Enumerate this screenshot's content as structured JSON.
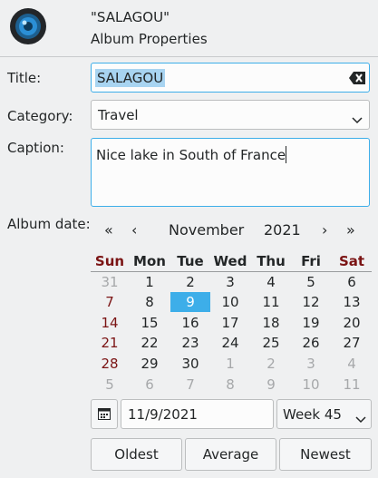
{
  "header": {
    "title": "\"SALAGOU\"",
    "subtitle": "Album Properties"
  },
  "form": {
    "title_label": "Title:",
    "title_value": "SALAGOU",
    "category_label": "Category:",
    "category_value": "Travel",
    "caption_label": "Caption:",
    "caption_value": "Nice lake in South of France",
    "date_label": "Album date:"
  },
  "calendar": {
    "nav_first": "«",
    "nav_prev": "‹",
    "month": "November",
    "year": "2021",
    "nav_next": "›",
    "nav_last": "»",
    "weekdays": [
      "Sun",
      "Mon",
      "Tue",
      "Wed",
      "Thu",
      "Fri",
      "Sat"
    ],
    "weeks": [
      [
        "31",
        "1",
        "2",
        "3",
        "4",
        "5",
        "6"
      ],
      [
        "7",
        "8",
        "9",
        "10",
        "11",
        "12",
        "13"
      ],
      [
        "14",
        "15",
        "16",
        "17",
        "18",
        "19",
        "20"
      ],
      [
        "21",
        "22",
        "23",
        "24",
        "25",
        "26",
        "27"
      ],
      [
        "28",
        "29",
        "30",
        "1",
        "2",
        "3",
        "4"
      ],
      [
        "5",
        "6",
        "7",
        "8",
        "9",
        "10",
        "11"
      ]
    ],
    "selected_day": "9",
    "date_value": "11/9/2021",
    "week_value": "Week 45"
  },
  "buttons": {
    "oldest": "Oldest",
    "average": "Average",
    "newest": "Newest"
  },
  "icons": {
    "album": "album-lens-icon",
    "clear": "clear-text-icon",
    "category_dropdown": "chevron-down-icon",
    "date_picker": "calendar-icon",
    "week_dropdown": "chevron-down-icon"
  },
  "colors": {
    "accent": "#3daee9",
    "weekend": "#7b1414",
    "selection_bg": "#a8d4f1"
  }
}
